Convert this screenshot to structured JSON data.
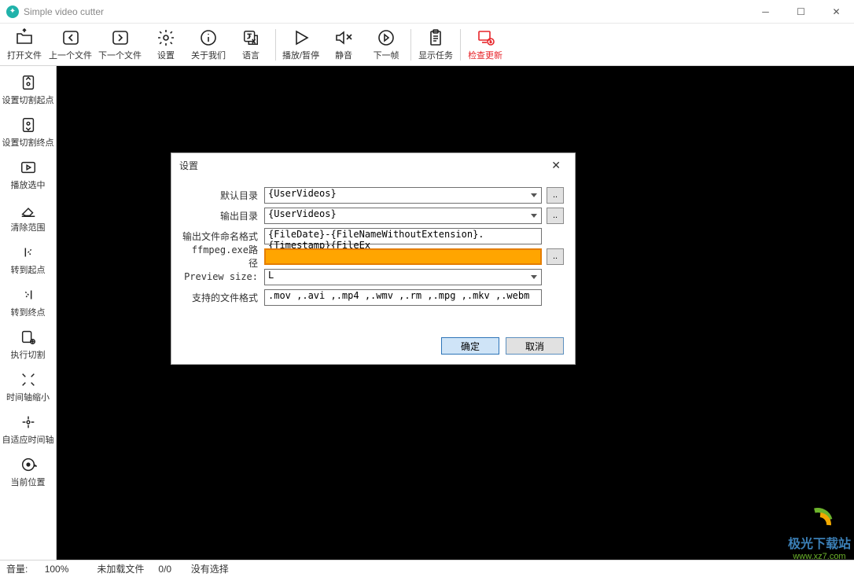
{
  "window": {
    "title": "Simple video cutter"
  },
  "toolbar": [
    {
      "id": "open-file",
      "label": "打开文件"
    },
    {
      "id": "prev-file",
      "label": "上一个文件"
    },
    {
      "id": "next-file",
      "label": "下一个文件"
    },
    {
      "id": "settings",
      "label": "设置"
    },
    {
      "id": "about",
      "label": "关于我们"
    },
    {
      "id": "language",
      "label": "语言"
    },
    {
      "id": "play-pause",
      "label": "播放/暂停"
    },
    {
      "id": "mute",
      "label": "静音"
    },
    {
      "id": "next-frame",
      "label": "下一帧"
    },
    {
      "id": "show-tasks",
      "label": "显示任务"
    },
    {
      "id": "check-update",
      "label": "检查更新",
      "red": true
    }
  ],
  "sidebar": [
    {
      "id": "set-start",
      "label": "设置切割起点"
    },
    {
      "id": "set-end",
      "label": "设置切割终点"
    },
    {
      "id": "play-selection",
      "label": "播放选中"
    },
    {
      "id": "clear-range",
      "label": "清除范围"
    },
    {
      "id": "to-start",
      "label": "转到起点"
    },
    {
      "id": "to-end",
      "label": "转到终点"
    },
    {
      "id": "do-cut",
      "label": "执行切割"
    },
    {
      "id": "timeline-zoom",
      "label": "时间轴缩小"
    },
    {
      "id": "fit-timeline",
      "label": "自适应时间轴"
    },
    {
      "id": "current-pos",
      "label": "当前位置"
    }
  ],
  "status": {
    "volume_label": "音量:",
    "volume_value": "100%",
    "file": "未加载文件",
    "sel": "0/0",
    "noselect": "没有选择"
  },
  "dialog": {
    "title": "设置",
    "labels": {
      "default_dir": "默认目录",
      "output_dir": "输出目录",
      "name_fmt": "输出文件命名格式",
      "ffmpeg": "ffmpeg.exe路径",
      "preview": "Preview size:",
      "formats": "支持的文件格式"
    },
    "values": {
      "default_dir": "{UserVideos}",
      "output_dir": "{UserVideos}",
      "name_fmt": "{FileDate}-{FileNameWithoutExtension}.{Timestamp}{FileEx",
      "ffmpeg": "",
      "preview": "L",
      "formats": ".mov ,.avi ,.mp4 ,.wmv ,.rm ,.mpg ,.mkv ,.webm"
    },
    "browse": "..",
    "ok": "确定",
    "cancel": "取消"
  },
  "watermark": {
    "line1": "极光下载站",
    "line2": "www.xz7.com"
  }
}
